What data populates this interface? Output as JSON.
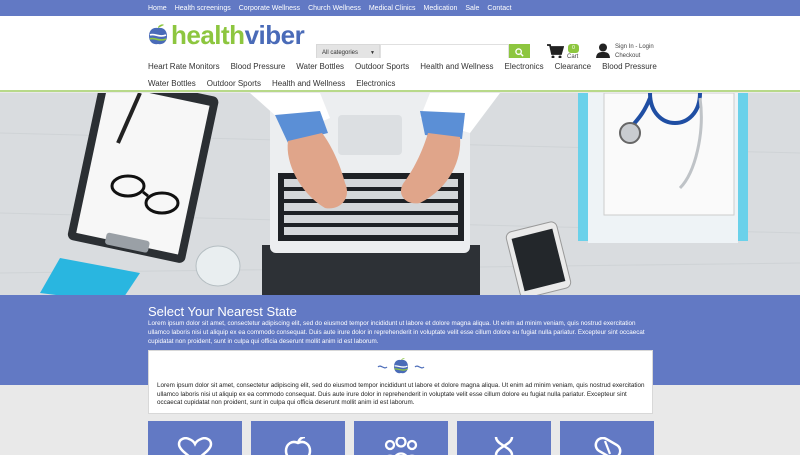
{
  "topnav": [
    "Home",
    "Health screenings",
    "Corporate Wellness",
    "Church Wellness",
    "Medical Clinics",
    "Medication",
    "Sale",
    "Contact"
  ],
  "brand": {
    "part1": "health",
    "part2": "viber"
  },
  "search": {
    "category": "All categories"
  },
  "cart": {
    "count": "0",
    "label": "Cart"
  },
  "account": {
    "line1": "Sign In - Login",
    "line2": "Checkout"
  },
  "categories_row1": [
    "Heart Rate Monitors",
    "Blood Pressure",
    "Water Bottles",
    "Outdoor Sports",
    "Health and Wellness",
    "Electronics",
    "Clearance",
    "Blood Pressure"
  ],
  "categories_row2": [
    "Water Bottles",
    "Outdoor Sports",
    "Health and Wellness",
    "Electronics"
  ],
  "section": {
    "title": "Select Your Nearest State",
    "intro": "Lorem ipsum dolor sit amet, consectetur adipiscing elit, sed do eiusmod tempor incididunt ut labore et dolore magna aliqua. Ut enim ad minim veniam, quis nostrud exercitation ullamco laboris nisi ut aliquip ex ea commodo consequat. Duis aute irure dolor in reprehenderit in voluptate velit esse cillum dolore eu fugiat nulla pariatur. Excepteur sint occaecat cupidatat non proident, sunt in culpa qui officia deserunt mollit anim id est laborum.",
    "card_text": "Lorem ipsum dolor sit amet, consectetur adipiscing elit, sed do eiusmod tempor incididunt ut labore et dolore magna aliqua. Ut enim ad minim veniam, quis nostrud exercitation ullamco laboris nisi ut aliquip ex ea commodo consequat. Duis aute irure dolor in reprehenderit in voluptate velit esse cillum dolore eu fugiat nulla pariatur. Excepteur sint occaecat cupidatat non proident, sunt in culpa qui officia deserunt mollit anim id est laborum."
  },
  "tiles": [
    {
      "icon": "heart-icon"
    },
    {
      "icon": "apple-icon"
    },
    {
      "icon": "people-icon"
    },
    {
      "icon": "dna-icon"
    },
    {
      "icon": "pill-icon"
    }
  ],
  "colors": {
    "primary": "#6279c4",
    "accent": "#8dc63f",
    "brand_blue": "#4a6bb8"
  }
}
